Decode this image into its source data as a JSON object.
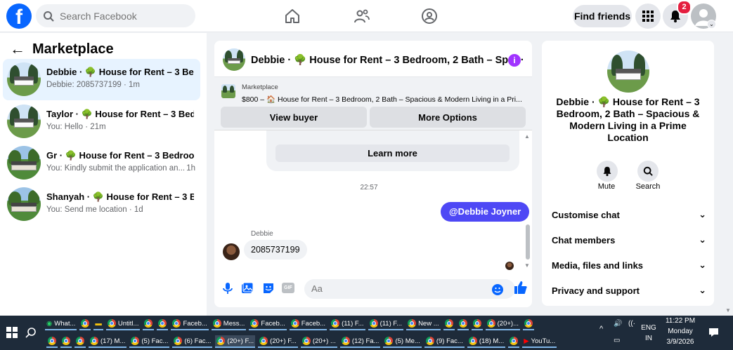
{
  "topbar": {
    "search_placeholder": "Search Facebook",
    "find_friends": "Find friends",
    "notif_badge": "2",
    "logo_letter": "f"
  },
  "left": {
    "title": "Marketplace",
    "conversations": [
      {
        "name": "Debbie · 🌳 House for Rent – 3 Be...",
        "sub": "Debbie: 2085737199 · 1m",
        "time": ""
      },
      {
        "name": "Taylor · 🌳 House for Rent – 3 Bed...",
        "sub": "You: Hello · 21m",
        "time": ""
      },
      {
        "name": "Gr · 🌳 House for Rent – 3 Bedroo...",
        "sub": "You: Kindly submit the application an...",
        "time": "1h"
      },
      {
        "name": "Shanyah · 🌳 House for Rent – 3 B...",
        "sub": "You: Send me location · 1d",
        "time": ""
      }
    ]
  },
  "chat": {
    "title": "Debbie · 🌳 House for Rent – 3 Bedroom, 2 Bath – Spa···",
    "info": "i",
    "listing_label": "Marketplace",
    "listing_price": "$800 – 🏠 House for Rent – 3 Bedroom, 2 Bath – Spacious & Modern Living in a Pri...",
    "view_buyer": "View buyer",
    "more_options": "More Options",
    "learn_more": "Learn more",
    "time": "22:57",
    "my_message": "@Debbie Joyner",
    "sender": "Debbie",
    "their_message": "2085737199",
    "input_placeholder": "Aa",
    "gif": "GIF"
  },
  "right": {
    "title": "Debbie · 🌳 House for Rent – 3 Bedroom, 2 Bath – Spacious & Modern Living in a Prime Location",
    "mute": "Mute",
    "search": "Search",
    "sections": [
      "Customise chat",
      "Chat members",
      "Media, files and links",
      "Privacy and support"
    ]
  },
  "taskbar": {
    "row1": [
      "What...",
      "",
      "",
      "Untitl...",
      "",
      "",
      "Faceb...",
      "Mess...",
      "Faceb...",
      "Faceb...",
      "(11) F...",
      "(11) F...",
      "New ...",
      "",
      "",
      "",
      "(20+)...",
      ""
    ],
    "row2": [
      "",
      "",
      "",
      "(17) M...",
      "(5) Fac...",
      "(6) Fac...",
      "(20+) F...",
      "(20+) F...",
      "(20+) ...",
      "(12) Fa...",
      "(5) Me...",
      "(9) Fac...",
      "(18) M...",
      "",
      "YouTu..."
    ],
    "lang1": "ENG",
    "lang2": "IN",
    "clock_time": "11:22 PM",
    "clock_day": "Monday",
    "clock_date": "3/9/2026"
  },
  "colors": {
    "fb_blue": "#0866ff",
    "my_bubble": "#4e48f5",
    "badge": "#e41e3f",
    "taskbar": "#1e2b3a"
  }
}
